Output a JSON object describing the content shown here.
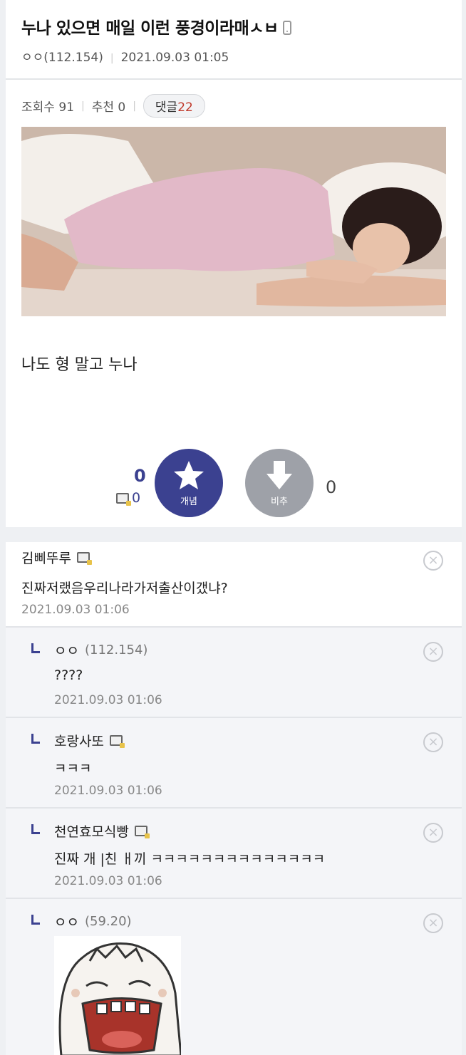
{
  "post": {
    "title": "누나 있으면 매일 이런 풍경이라매ㅅㅂ",
    "author": "ㅇㅇ(112.154)",
    "datetime": "2021.09.03 01:05",
    "views_label": "조회수 91",
    "recommend_label": "추천 0",
    "comment_label": "댓글",
    "comment_count": "22",
    "body_text": "나도 형 말고 누나"
  },
  "votes": {
    "up_count": "0",
    "fixed_up_count": "0",
    "up_label": "개념",
    "down_label": "비추",
    "down_count": "0",
    "up_color": "#3b4190",
    "down_color": "#9ea1a8"
  },
  "comments": [
    {
      "author": "김삐뚜루",
      "text": "진짜저랬음우리나라가저출산이갰냐?",
      "date": "2021.09.03 01:06"
    },
    {
      "author": "ㅇㅇ",
      "ip": "(112.154)",
      "text": "????",
      "date": "2021.09.03 01:06"
    },
    {
      "author": "호랑사또",
      "text": "ㅋㅋㅋ",
      "date": "2021.09.03 01:06"
    },
    {
      "author": "천연효모식빵",
      "text": "진짜 개 |친 ㅐ끼 ㅋㅋㅋㅋㅋㅋㅋㅋㅋㅋㅋㅋㅋㅋ",
      "date": "2021.09.03 01:06"
    },
    {
      "author": "ㅇㅇ",
      "ip": "(59.20)"
    }
  ],
  "icons": {
    "delete": "close-circle-icon",
    "fixnick": "fixed-nick-icon",
    "mobile": "mobile-icon",
    "star": "star-icon",
    "arrow_down": "arrow-down-icon"
  }
}
